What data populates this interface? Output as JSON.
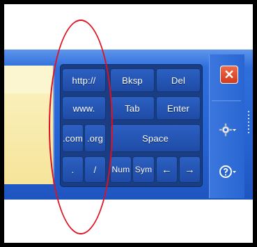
{
  "keys": {
    "http": "http://",
    "www": "www.",
    "com": ".com",
    "org": ".org",
    "dot": ".",
    "slash": "/",
    "bksp": "Bksp",
    "del": "Del",
    "tab": "Tab",
    "enter": "Enter",
    "space": "Space",
    "num": "Num",
    "sym": "Sym",
    "left": "←",
    "right": "→"
  },
  "side": {
    "close_glyph": "✕"
  },
  "colors": {
    "toolbar_blue": "#2663d2",
    "key_blue": "#2c60c2",
    "close_red": "#d33a1c",
    "highlight_circle": "#e01020"
  },
  "icons": {
    "close": "close-icon",
    "settings": "gear-icon",
    "help": "help-icon"
  }
}
